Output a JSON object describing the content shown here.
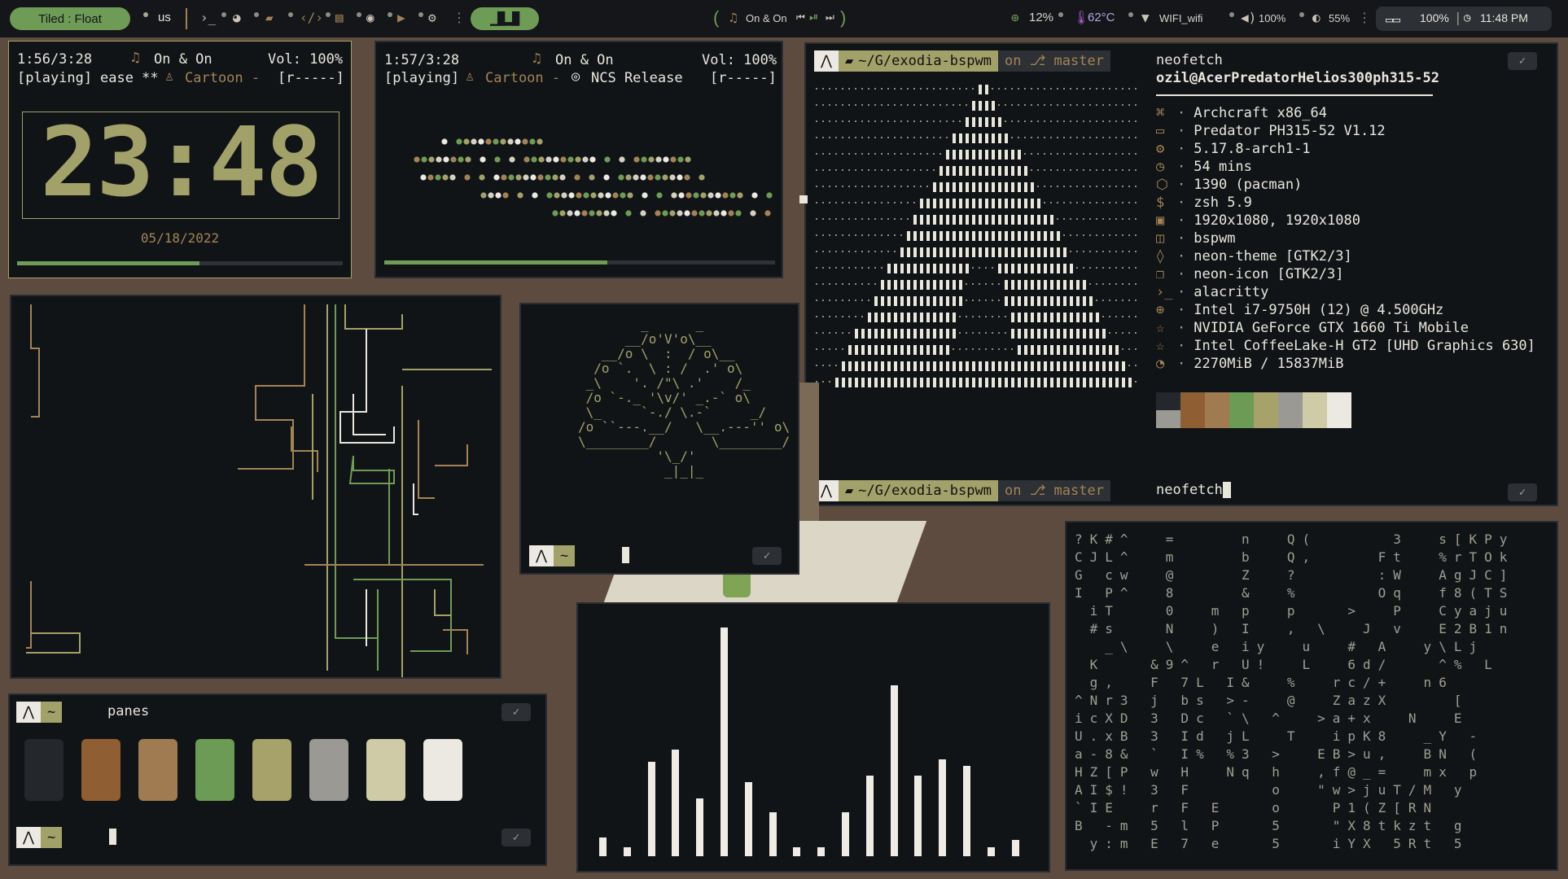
{
  "topbar": {
    "layout_mode": "Tiled : Float",
    "keyboard": "us",
    "now_playing": "On & On",
    "cpu": "12%",
    "temp": "62°C",
    "wifi": "WIFI_wifi",
    "volume": "100%",
    "brightness": "55%",
    "battery": "100%",
    "time": "11:48 PM",
    "icons": [
      "terminal-icon",
      "firefox-icon",
      "folder-icon",
      "code-icon",
      "book-icon",
      "chat-icon",
      "youtube-icon",
      "settings-icon",
      "menu-icon",
      "workspaces-icon",
      "music-icon",
      "prev-icon",
      "play-pause-icon",
      "next-icon",
      "cpu-icon",
      "thermometer-icon",
      "wifi-icon",
      "volume-icon",
      "brightness-icon",
      "battery-icon",
      "clock-icon"
    ]
  },
  "player1": {
    "position": "1:56/3:28",
    "title": "On & On",
    "volume": "Vol: 100%",
    "state": "[playing]",
    "subtitle": "ease **",
    "artist": "Cartoon -",
    "flags": "[r-----]",
    "progress": 0.56
  },
  "clock": {
    "time": "23:48",
    "date": "05/18/2022"
  },
  "player2": {
    "position": "1:57/3:28",
    "title": "On & On",
    "volume": "Vol: 100%",
    "state": "[playing]",
    "artist": "Cartoon -",
    "album": "NCS Release",
    "flags": "[r-----]",
    "progress": 0.57
  },
  "neofetch": {
    "prompt_path": "~/G/exodia-bspwm",
    "prompt_on": "on",
    "prompt_branch": "master",
    "command": "neofetch",
    "user_host": "ozil@AcerPredatorHelios300ph315-52",
    "lines": [
      {
        "icon": "command-icon",
        "glyph": "⌘",
        "value": "Archcraft x86_64"
      },
      {
        "icon": "monitor-icon",
        "glyph": "▭",
        "value": "Predator PH315-52 V1.12"
      },
      {
        "icon": "gear-icon",
        "glyph": "⚙",
        "value": "5.17.8-arch1-1"
      },
      {
        "icon": "clock-icon",
        "glyph": "◷",
        "value": "54 mins"
      },
      {
        "icon": "package-icon",
        "glyph": "⬡",
        "value": "1390 (pacman)"
      },
      {
        "icon": "dollar-icon",
        "glyph": "$",
        "value": "zsh 5.9"
      },
      {
        "icon": "image-icon",
        "glyph": "▣",
        "value": "1920x1080, 1920x1080"
      },
      {
        "icon": "window-icon",
        "glyph": "◫",
        "value": "bspwm"
      },
      {
        "icon": "drop-icon",
        "glyph": "◊",
        "value": "neon-theme [GTK2/3]"
      },
      {
        "icon": "copy-icon",
        "glyph": "❐",
        "value": "neon-icon [GTK2/3]"
      },
      {
        "icon": "prompt-icon",
        "glyph": "›_",
        "value": "alacritty"
      },
      {
        "icon": "chip-icon",
        "glyph": "⊕",
        "value": "Intel i7-9750H (12) @ 4.500GHz"
      },
      {
        "icon": "star-icon",
        "glyph": "☆",
        "value": "NVIDIA GeForce GTX 1660 Ti Mobile"
      },
      {
        "icon": "star-icon",
        "glyph": "☆",
        "value": "Intel CoffeeLake-H GT2 [UHD Graphics 630]"
      },
      {
        "icon": "pie-icon",
        "glyph": "◔",
        "value": "2270MiB / 15837MiB"
      }
    ],
    "palette_top": [
      "#24272b",
      "#8f5f33",
      "#a07a50",
      "#6b9b55",
      "#a7a26a",
      "#9a9994",
      "#cfcba7",
      "#ece8e2"
    ],
    "palette_bottom": [
      "#9a9994",
      "#8f5f33",
      "#a07a50",
      "#6b9b55",
      "#a7a26a",
      "#9a9994",
      "#cfcba7",
      "#ece8e2"
    ],
    "check": "✓",
    "next_command": "neofetch"
  },
  "small_term": {
    "home": "~",
    "check": "✓"
  },
  "panes": {
    "home": "~",
    "command": "panes",
    "check": "✓",
    "colors": [
      "#24272b",
      "#8f5f33",
      "#a07a50",
      "#6b9b55",
      "#a7a26a",
      "#9a9994",
      "#cfcba7",
      "#ece8e2"
    ]
  },
  "cava": {
    "values": [
      0.08,
      0.04,
      0.41,
      0.46,
      0.25,
      0.99,
      0.32,
      0.19,
      0.04,
      0.04,
      0.19,
      0.35,
      0.74,
      0.35,
      0.42,
      0.39,
      0.04,
      0.07
    ]
  },
  "matrix": {
    "rows": [
      "?K#^  =    n  Q(     3  s[KPy",
      "CJL^  m    b  Q,    Ft  %rTOk",
      "G cw  @    Z  ?     :W  AgJC]",
      "I P^  8    &  %     Oq  f8(TS",
      " iT   0  m p  p   >  P  Cyaju",
      " #s   N  ) I  , \\  J v  E2B1n",
      "  _\\  \\  e iy  u  # A  y\\Lj",
      " K   &9^ r U!  L  6d/   ^% L",
      " g,  F 7L I&  %  rc/+  n6",
      "^Nr3 j bs >-  @  ZazX    [",
      "icXD 3 Dc `\\ ^  >a+x  N  E",
      "U.xB 3 Id jL  T  ipK8  _Y -",
      "a-8& ` I% %3 >  EB>u,  BN (",
      "HZ[P w H  Nq h  ,f@_=  mx p",
      "AI$! 3 F     o  \"w>juT/M y",
      "`IE  r F E   o   P1(Z[RN",
      "B -m 5 l P   5   \"X8tkzt g",
      " y:m E 7 e   5   iYX 5Rt 5"
    ]
  }
}
